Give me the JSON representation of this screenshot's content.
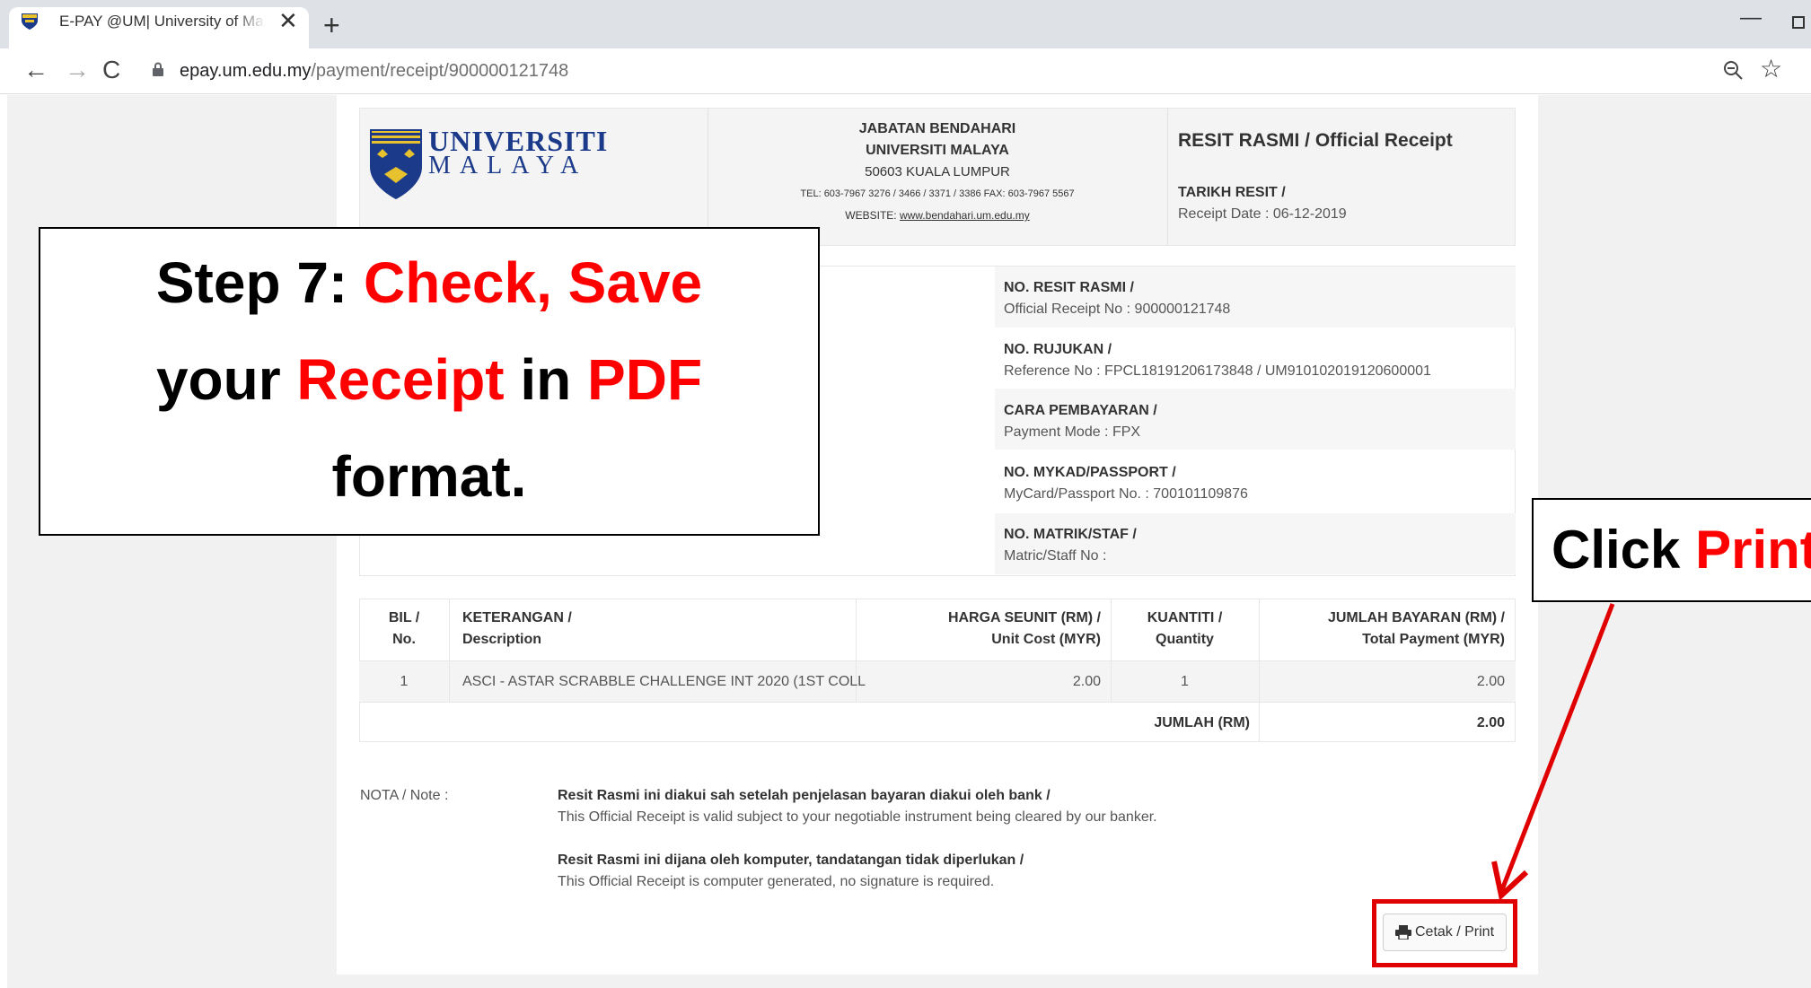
{
  "browser": {
    "tab_title": "E-PAY @UM| University of Malaya",
    "tab_close": "✕",
    "new_tab": "+",
    "minimize": "—",
    "url_host": "epay.um.edu.my",
    "url_path": "/payment/receipt/900000121748",
    "star": "☆",
    "nav_back": "←",
    "nav_forward": "→",
    "nav_reload": "C"
  },
  "header": {
    "logo_line1": "UNIVERSITI",
    "logo_line2": "MALAYA",
    "dept": "JABATAN BENDAHARI",
    "university": "UNIVERSITI MALAYA",
    "address": "50603 KUALA LUMPUR",
    "tel": "TEL: 603-7967 3276 / 3466 / 3371 / 3386 FAX: 603-7967 5567",
    "website_label": "WEBSITE:",
    "website_link": "www.bendahari.um.edu.my",
    "receipt_title": "RESIT RASMI / Official Receipt",
    "receipt_date_label": "TARIKH RESIT /",
    "receipt_date_value": "Receipt Date : 06-12-2019"
  },
  "info": [
    {
      "label": "NO. RESIT RASMI /",
      "value": "Official Receipt No : 900000121748"
    },
    {
      "label": "NO. RUJUKAN /",
      "value": "Reference No : FPCL18191206173848 / UM910102019120600001"
    },
    {
      "label": "CARA PEMBAYARAN /",
      "value": "Payment Mode : FPX"
    },
    {
      "label": "NO. MYKAD/PASSPORT /",
      "value": "MyCard/Passport No. : 700101109876"
    },
    {
      "label": "NO. MATRIK/STAF /",
      "value": "Matric/Staff No :"
    }
  ],
  "table": {
    "headers": {
      "bil_1": "BIL /",
      "bil_2": "No.",
      "desc_1": "KETERANGAN /",
      "desc_2": "Description",
      "unit_1": "HARGA SEUNIT (RM) /",
      "unit_2": "Unit Cost (MYR)",
      "qty_1": "KUANTITI /",
      "qty_2": "Quantity",
      "total_1": "JUMLAH BAYARAN (RM) /",
      "total_2": "Total Payment (MYR)"
    },
    "row": {
      "no": "1",
      "description": "ASCI - ASTAR SCRABBLE CHALLENGE INT 2020 (1ST COLL",
      "unit_cost": "2.00",
      "quantity": "1",
      "total": "2.00"
    },
    "sum_label": "JUMLAH (RM)",
    "sum_value": "2.00"
  },
  "notes": {
    "label": "NOTA / Note :",
    "note1_bold": "Resit Rasmi ini diakui sah setelah penjelasan bayaran diakui oleh bank /",
    "note1_text": "This Official Receipt is valid subject to your negotiable instrument being cleared by our banker.",
    "note2_bold": "Resit Rasmi ini dijana oleh komputer, tandatangan tidak diperlukan /",
    "note2_text": "This Official Receipt is computer generated, no signature is required."
  },
  "print_button": "Cetak / Print",
  "annotation": {
    "step_a": "Step 7: ",
    "step_b": "Check, Save",
    "step_c": "your ",
    "step_d": "Receipt",
    "step_e": " in ",
    "step_f": "PDF",
    "step_g": "format.",
    "click_a": "Click ",
    "click_b": "Print"
  },
  "colors": {
    "highlight": "#ff0000",
    "brand": "#1b3a8a"
  }
}
